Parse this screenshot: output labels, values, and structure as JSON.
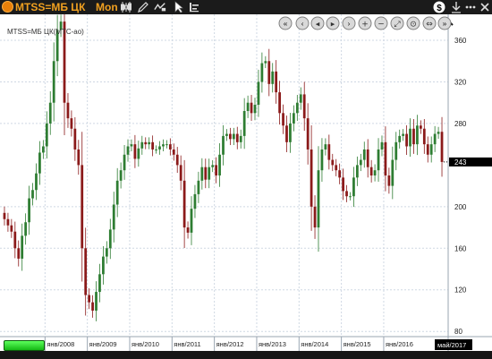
{
  "window": {
    "symbol": "MTSS=МБ ЦК",
    "period": "Mon",
    "icons": [
      "app-icon",
      "candles-icon",
      "pencil-icon",
      "drawing-tools-icon",
      "cursor-icon",
      "indicators-icon",
      "currency-icon",
      "download-icon",
      "more-icon",
      "close-icon"
    ]
  },
  "chart": {
    "legend_label": "MTSS=МБ ЦК(МТС-ао)",
    "last_price_label": "243",
    "last_date_label": "май/2017",
    "navigation_buttons": [
      "scroll-first-button",
      "scroll-back-button",
      "scroll-left-button",
      "scroll-right-button",
      "scroll-forward-button",
      "zoom-in-button",
      "zoom-out-button",
      "zoom-fit-button",
      "zoom-reset-button",
      "stretch-button",
      "scroll-last-button"
    ],
    "colors": {
      "up": "#2e7d32",
      "down": "#8b1a1a",
      "grid": "#cfd8e3",
      "background": "#ffffff",
      "last_price_bg": "#000000"
    }
  },
  "chart_data": {
    "type": "candlestick",
    "title": "MTSS=МБ ЦК(МТС-ао)",
    "x": [
      "2007-01",
      "2007-02",
      "2007-03",
      "2007-04",
      "2007-05",
      "2007-06",
      "2007-07",
      "2007-08",
      "2007-09",
      "2007-10",
      "2007-11",
      "2007-12",
      "2008-01",
      "2008-02",
      "2008-03",
      "2008-04",
      "2008-05",
      "2008-06",
      "2008-07",
      "2008-08",
      "2008-09",
      "2008-10",
      "2008-11",
      "2008-12",
      "2009-01",
      "2009-02",
      "2009-03",
      "2009-04",
      "2009-05",
      "2009-06",
      "2009-07",
      "2009-08",
      "2009-09",
      "2009-10",
      "2009-11",
      "2009-12",
      "2010-01",
      "2010-02",
      "2010-03",
      "2010-04",
      "2010-05",
      "2010-06",
      "2010-07",
      "2010-08",
      "2010-09",
      "2010-10",
      "2010-11",
      "2010-12",
      "2011-01",
      "2011-02",
      "2011-03",
      "2011-04",
      "2011-05",
      "2011-06",
      "2011-07",
      "2011-08",
      "2011-09",
      "2011-10",
      "2011-11",
      "2011-12",
      "2012-01",
      "2012-02",
      "2012-03",
      "2012-04",
      "2012-05",
      "2012-06",
      "2012-07",
      "2012-08",
      "2012-09",
      "2012-10",
      "2012-11",
      "2012-12",
      "2013-01",
      "2013-02",
      "2013-03",
      "2013-04",
      "2013-05",
      "2013-06",
      "2013-07",
      "2013-08",
      "2013-09",
      "2013-10",
      "2013-11",
      "2013-12",
      "2014-01",
      "2014-02",
      "2014-03",
      "2014-04",
      "2014-05",
      "2014-06",
      "2014-07",
      "2014-08",
      "2014-09",
      "2014-10",
      "2014-11",
      "2014-12",
      "2015-01",
      "2015-02",
      "2015-03",
      "2015-04",
      "2015-05",
      "2015-06",
      "2015-07",
      "2015-08",
      "2015-09",
      "2015-10",
      "2015-11",
      "2015-12",
      "2016-01",
      "2016-02",
      "2016-03",
      "2016-04",
      "2016-05",
      "2016-06",
      "2016-07",
      "2016-08",
      "2016-09",
      "2016-10",
      "2016-11",
      "2016-12",
      "2017-01",
      "2017-02",
      "2017-03",
      "2017-04",
      "2017-05"
    ],
    "close": [
      188,
      182,
      176,
      160,
      150,
      172,
      185,
      208,
      216,
      232,
      252,
      258,
      280,
      300,
      340,
      370,
      378,
      300,
      285,
      275,
      255,
      240,
      160,
      115,
      108,
      100,
      118,
      135,
      152,
      160,
      178,
      202,
      225,
      235,
      250,
      258,
      260,
      246,
      256,
      262,
      260,
      262,
      255,
      255,
      258,
      260,
      260,
      255,
      250,
      240,
      225,
      180,
      175,
      198,
      212,
      225,
      238,
      226,
      238,
      240,
      230,
      250,
      268,
      270,
      265,
      270,
      262,
      268,
      292,
      300,
      290,
      298,
      320,
      338,
      340,
      318,
      330,
      310,
      290,
      278,
      262,
      280,
      290,
      300,
      308,
      285,
      255,
      200,
      180,
      235,
      255,
      260,
      245,
      240,
      235,
      228,
      215,
      210,
      210,
      228,
      240,
      245,
      255,
      238,
      230,
      235,
      255,
      262,
      230,
      220,
      245,
      262,
      268,
      270,
      258,
      275,
      260,
      278,
      275,
      260,
      250,
      260,
      270,
      272,
      243
    ],
    "y_ticks": [
      80,
      120,
      160,
      200,
      243,
      280,
      320,
      360
    ],
    "x_tick_labels": [
      "янв/2008",
      "янв/2009",
      "янв/2010",
      "янв/2011",
      "янв/2012",
      "янв/2013",
      "янв/2014",
      "янв/2015",
      "янв/2016",
      "май/2017"
    ],
    "ylim": [
      75,
      385
    ],
    "grid": true,
    "legend": "top-left"
  }
}
